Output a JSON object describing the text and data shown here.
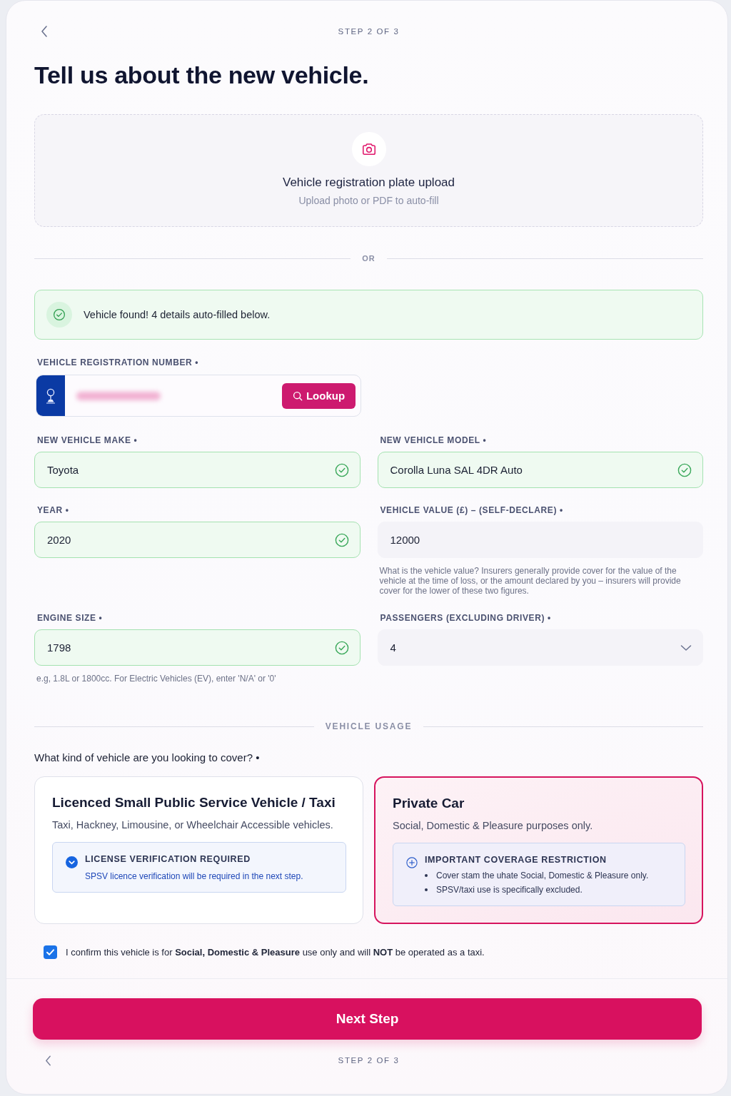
{
  "header": {
    "step": "STEP 2 OF 3"
  },
  "title": "Tell us about the new vehicle.",
  "upload": {
    "title": "Vehicle registration plate upload",
    "subtitle": "Upload photo or PDF to auto-fill"
  },
  "or_divider": "OR",
  "alert": {
    "kind": "success",
    "text": "Vehicle found! 4 details auto-filled below."
  },
  "registration": {
    "label": "VEHICLE REGISTRATION NUMBER •",
    "value_hidden": true,
    "button": "Lookup"
  },
  "fields": [
    {
      "kind": "input",
      "label": "NEW VEHICLE MAKE •",
      "value": "Toyota",
      "verified": true
    },
    {
      "kind": "input",
      "label": "NEW VEHICLE MODEL •",
      "value": "Corolla Luna SAL 4DR Auto",
      "verified": true
    },
    {
      "kind": "input",
      "label": "YEAR •",
      "value": "2020",
      "verified": true
    },
    {
      "kind": "input",
      "label": "VEHICLE VALUE (£) – (SELF-DECLARE) •",
      "value": "12000",
      "verified": false,
      "help": "What is the vehicle value? Insurers generally provide cover for the value of the vehicle at the time of loss, or the amount declared by you – insurers will provide cover for the lower of these two figures."
    },
    {
      "kind": "input",
      "label": "ENGINE SIZE •",
      "value": "1798",
      "verified": true,
      "help": "e.g, 1.8L or 1800cc. For Electric Vehicles (EV), enter 'N/A' or '0'"
    },
    {
      "kind": "select",
      "label": "PASSENGERS (EXCLUDING DRIVER) •",
      "value": "4",
      "verified": false
    }
  ],
  "usage": {
    "heading": "VEHICLE USAGE",
    "question": "What kind of vehicle are you looking to cover? •",
    "options": [
      {
        "title": "Licenced Small Public Service Vehicle / Taxi",
        "description": "Taxi, Hackney, Limousine, or Wheelchair Accessible vehicles.",
        "selected": false,
        "note": {
          "kind": "info",
          "title": "LICENSE VERIFICATION REQUIRED",
          "text": "SPSV licence verification will be required in the next step."
        }
      },
      {
        "title": "Private Car",
        "description": "Social, Domestic & Pleasure purposes only.",
        "selected": true,
        "note": {
          "kind": "restriction",
          "title": "IMPORTANT COVERAGE RESTRICTION",
          "bullets": [
            "Cover stam the uhate Social, Domestic & Pleasure only.",
            "SPSV/taxi use is specifically excluded."
          ]
        }
      }
    ]
  },
  "confirm": {
    "checked": true,
    "text": "I confirm this vehicle is for **Social, Domestic & Pleasure** use only and will **NOT** be operated as a taxi."
  },
  "footer": {
    "button": "Next Step",
    "step": "STEP 2 OF 3"
  }
}
